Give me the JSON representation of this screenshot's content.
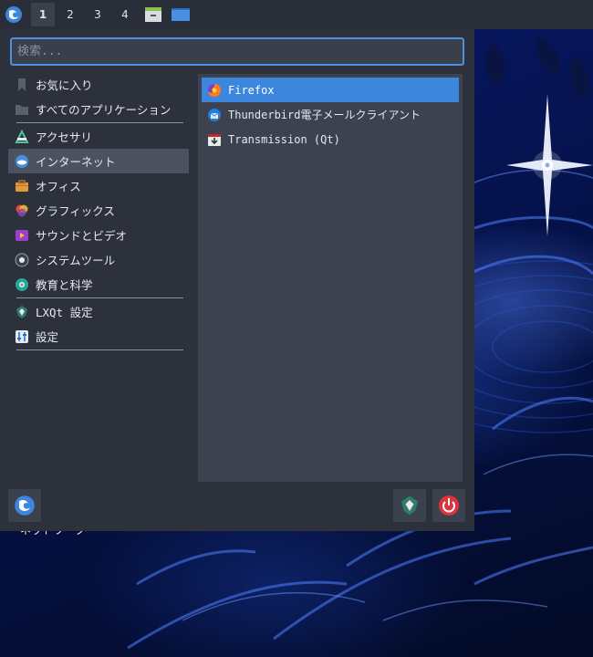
{
  "panel": {
    "desktops": [
      {
        "label": "1",
        "active": true
      },
      {
        "label": "2",
        "active": false
      },
      {
        "label": "3",
        "active": false
      },
      {
        "label": "4",
        "active": false
      }
    ]
  },
  "menu": {
    "search_placeholder": "検索...",
    "categories": [
      {
        "label": "お気に入り",
        "icon": "bookmark-icon"
      },
      {
        "label": "すべてのアプリケーション",
        "icon": "folder-icon"
      },
      {
        "label": "アクセサリ",
        "icon": "accessories-icon"
      },
      {
        "label": "インターネット",
        "icon": "internet-icon",
        "selected": true
      },
      {
        "label": "オフィス",
        "icon": "briefcase-icon"
      },
      {
        "label": "グラフィックス",
        "icon": "graphics-icon"
      },
      {
        "label": "サウンドとビデオ",
        "icon": "multimedia-icon"
      },
      {
        "label": "システムツール",
        "icon": "gear-icon"
      },
      {
        "label": "教育と科学",
        "icon": "education-icon"
      },
      {
        "label": "LXQt 設定",
        "icon": "lxqt-icon"
      },
      {
        "label": "設定",
        "icon": "settings-icon"
      }
    ],
    "apps": [
      {
        "label": "Firefox",
        "icon": "firefox-icon",
        "selected": true
      },
      {
        "label": "Thunderbird電子メールクライアント",
        "icon": "thunderbird-icon"
      },
      {
        "label": "Transmission (Qt)",
        "icon": "transmission-icon"
      }
    ]
  },
  "desktop": {
    "label": "ネットワーク"
  },
  "colors": {
    "accent": "#3d86dd",
    "menu_bg": "#2c313b",
    "app_panel_bg": "#3c424f",
    "power": "#e0323a"
  }
}
